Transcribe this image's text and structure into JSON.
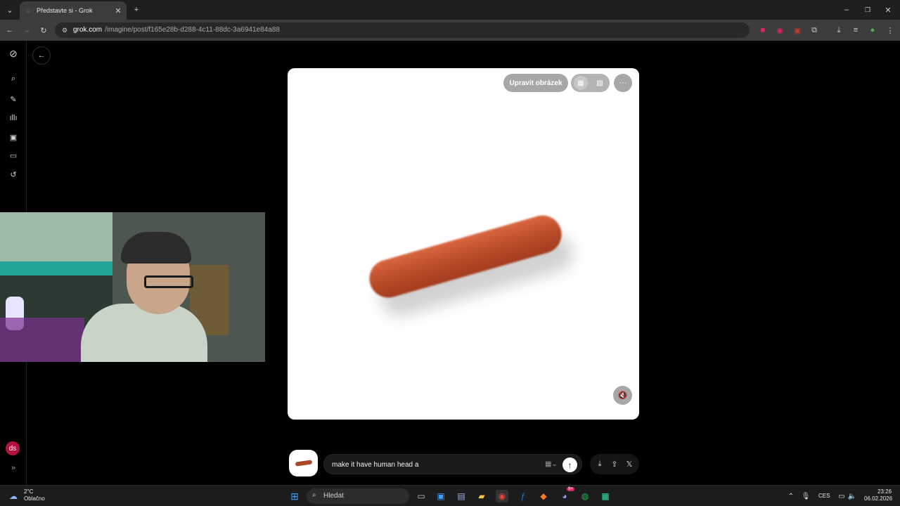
{
  "browser": {
    "tab_title": "Představte si - Grok",
    "url_domain": "grok.com",
    "url_path": "/imagine/post/f165e28b-d288-4c11-88dc-3a6941e84a88",
    "icons": [
      "back-icon",
      "forward-icon",
      "reload-icon",
      "site-info-icon",
      "translate-icon",
      "cast-icon",
      "star-icon",
      "extension-icons",
      "download-icon",
      "media-icon",
      "profile-icon",
      "menu-icon"
    ]
  },
  "sidebar": {
    "items": [
      "grok-logo",
      "search",
      "edit",
      "voice",
      "imagine",
      "projects",
      "history"
    ],
    "avatar_initials": "ds"
  },
  "image_card": {
    "edit_button_label": "Upravit obrázek",
    "subject": "hot dog sausage"
  },
  "prompt": {
    "value": "make it have human head a",
    "mode_icon": "video-icon"
  },
  "taskbar": {
    "weather_temp": "2°C",
    "weather_desc": "Oblačno",
    "search_placeholder": "Hledat",
    "language": "CES",
    "time": "23:26",
    "date": "06.02.2026",
    "discord_badge": "9+"
  },
  "colors": {
    "accent_avatar": "#b3123f",
    "card_bg": "#ffffff",
    "page_bg": "#000000"
  }
}
